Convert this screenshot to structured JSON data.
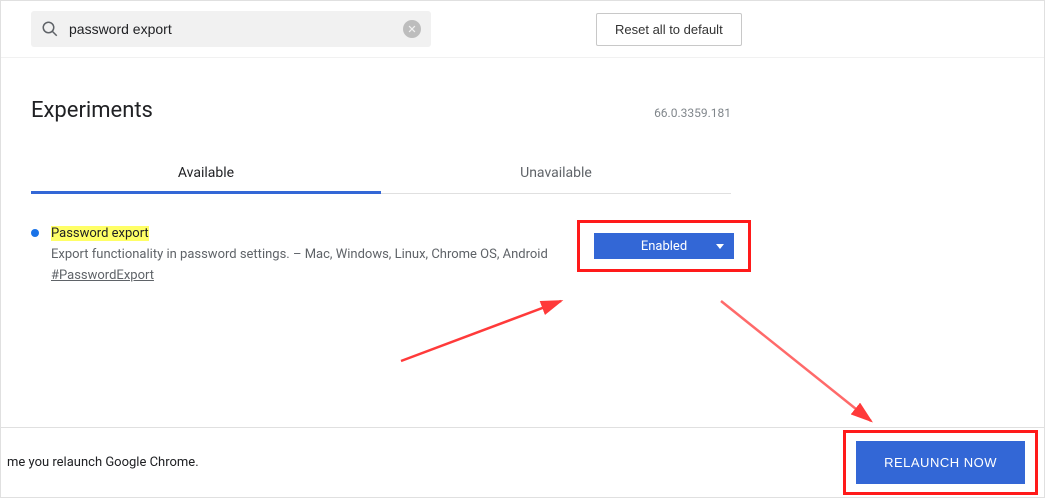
{
  "search": {
    "value": "password export"
  },
  "reset_label": "Reset all to default",
  "title": "Experiments",
  "version": "66.0.3359.181",
  "tabs": {
    "available": "Available",
    "unavailable": "Unavailable"
  },
  "flag": {
    "title": "Password export",
    "desc": "Export functionality in password settings. – Mac, Windows, Linux, Chrome OS, Android",
    "hash": "#PasswordExport",
    "dropdown_value": "Enabled"
  },
  "footer": {
    "text": "me you relaunch Google Chrome.",
    "relaunch_label": "RELAUNCH NOW"
  }
}
